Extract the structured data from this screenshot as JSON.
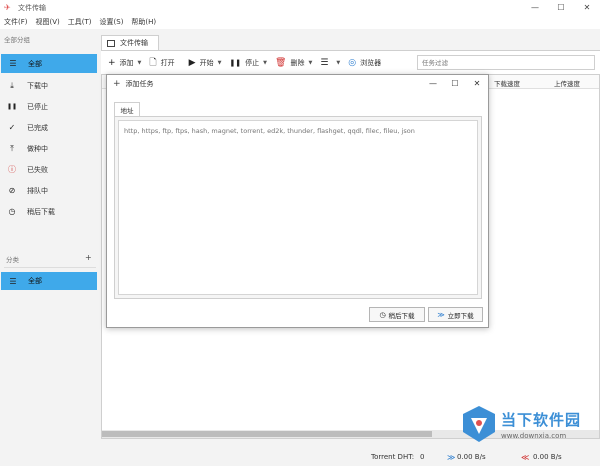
{
  "window": {
    "title": "文件传输",
    "controls": [
      "—",
      "☐",
      "✕"
    ]
  },
  "menu": [
    "文件(F)",
    "视图(V)",
    "工具(T)",
    "设置(S)",
    "帮助(H)"
  ],
  "sidebar": {
    "header": "全部分组",
    "items": [
      {
        "label": "全部",
        "icon": "list-icon",
        "glyph": "☰",
        "active": true
      },
      {
        "label": "下载中",
        "icon": "download-icon",
        "glyph": "⤓",
        "active": false
      },
      {
        "label": "已停止",
        "icon": "pause-icon",
        "glyph": "❚❚",
        "active": false
      },
      {
        "label": "已完成",
        "icon": "check-icon",
        "glyph": "✓",
        "active": false
      },
      {
        "label": "做种中",
        "icon": "upload-icon",
        "glyph": "⤒",
        "active": false
      },
      {
        "label": "已失败",
        "icon": "error-shield-icon",
        "glyph": "ⓘ",
        "active": false
      },
      {
        "label": "排队中",
        "icon": "queue-icon",
        "glyph": "⊘",
        "active": false
      },
      {
        "label": "稍后下载",
        "icon": "clock-icon",
        "glyph": "◷",
        "active": false
      }
    ],
    "category_header": "分类",
    "category_add": "+",
    "categories": [
      {
        "label": "全部",
        "icon": "list-icon",
        "glyph": "☰",
        "active": true
      }
    ]
  },
  "tab": {
    "label": "文件传输"
  },
  "toolbar": {
    "add": "添加",
    "open": "打开",
    "start": "开始",
    "stop": "停止",
    "delete": "删除",
    "browser": "浏览器",
    "filter_placeholder": "任务过滤"
  },
  "columns": {
    "download_speed": "下载速度",
    "upload_speed": "上传速度"
  },
  "status": {
    "dht_label": "Torrent DHT:",
    "dht_value": "0",
    "down_speed": "0.00 B/s",
    "up_speed": "0.00 B/s"
  },
  "dialog": {
    "title": "添加任务",
    "tab": "地址",
    "placeholder": "http, https, ftp, ftps, hash, magnet, torrent, ed2k, thunder, flashget, qqdl, filec, fileu, json",
    "later_button": "稍后下载",
    "now_button": "立即下载"
  },
  "watermark": {
    "title": "当下软件园",
    "url": "www.downxia.com"
  }
}
